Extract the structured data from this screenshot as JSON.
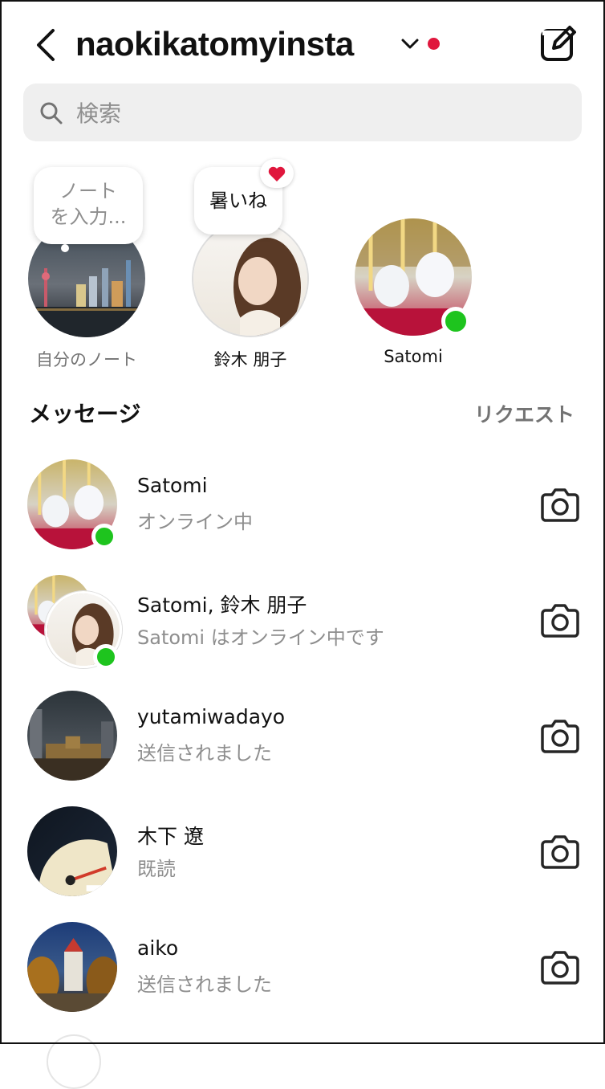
{
  "header": {
    "username": "naokikatomyinsta",
    "notification_color": "#e0173d"
  },
  "search": {
    "placeholder": "検索"
  },
  "notes": [
    {
      "note_text": "ノート\nを入力...",
      "label": "自分のノート"
    },
    {
      "note_text": "暑いね",
      "label": "鈴木 朋子",
      "reaction": "heart"
    },
    {
      "label": "Satomi",
      "online": true
    }
  ],
  "section": {
    "title": "メッセージ",
    "requests_label": "リクエスト"
  },
  "threads": [
    {
      "name": "Satomi",
      "status": "オンライン中",
      "online": true
    },
    {
      "name": "Satomi, 鈴木 朋子",
      "status": "Satomi はオンライン中です",
      "online": true,
      "group": true
    },
    {
      "name": "yutamiwadayo",
      "status": "送信されました"
    },
    {
      "name": "木下 遼",
      "status": "既読"
    },
    {
      "name": "aiko",
      "status": "送信されました"
    }
  ],
  "colors": {
    "online": "#1ec41e",
    "heart": "#e0173d",
    "muted": "#8e8e8e",
    "search_bg": "#efefef"
  },
  "icons": [
    "back-arrow-icon",
    "chevron-down-icon",
    "compose-icon",
    "search-icon",
    "camera-icon",
    "heart-icon"
  ]
}
